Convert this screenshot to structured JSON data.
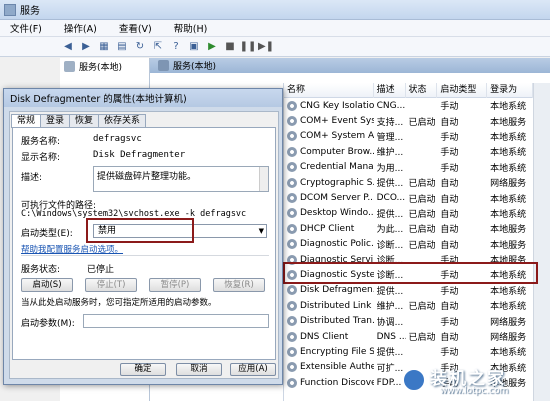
{
  "window": {
    "title": "服务"
  },
  "menu": [
    "文件(F)",
    "操作(A)",
    "查看(V)",
    "帮助(H)"
  ],
  "tree": {
    "item": "服务(本地)"
  },
  "panel_header": "服务(本地)",
  "table": {
    "columns": [
      "名称",
      "描述",
      "状态",
      "启动类型",
      "登录为"
    ],
    "rows": [
      [
        "CNG Key Isolation",
        "CNG...",
        "",
        "手动",
        "本地系统"
      ],
      [
        "COM+ Event Sys...",
        "支持...",
        "已启动",
        "自动",
        "本地服务"
      ],
      [
        "COM+ System A...",
        "管理...",
        "",
        "手动",
        "本地系统"
      ],
      [
        "Computer Brow...",
        "维护...",
        "",
        "手动",
        "本地系统"
      ],
      [
        "Credential Mana...",
        "为用...",
        "",
        "手动",
        "本地系统"
      ],
      [
        "Cryptographic S...",
        "提供...",
        "已启动",
        "自动",
        "网络服务"
      ],
      [
        "DCOM Server P...",
        "DCO...",
        "已启动",
        "自动",
        "本地系统"
      ],
      [
        "Desktop Windo...",
        "提供...",
        "已启动",
        "自动",
        "本地系统"
      ],
      [
        "DHCP Client",
        "为此...",
        "已启动",
        "自动",
        "本地服务"
      ],
      [
        "Diagnostic Polic...",
        "诊断...",
        "已启动",
        "自动",
        "本地服务"
      ],
      [
        "Diagnostic Servi...",
        "诊断...",
        "",
        "手动",
        "本地服务"
      ],
      [
        "Diagnostic Syste...",
        "诊断...",
        "",
        "手动",
        "本地系统"
      ],
      [
        "Disk Defragmen...",
        "提供...",
        "",
        "手动",
        "本地系统"
      ],
      [
        "Distributed Link ...",
        "维护...",
        "已启动",
        "自动",
        "本地系统"
      ],
      [
        "Distributed Tran...",
        "协调...",
        "",
        "手动",
        "网络服务"
      ],
      [
        "DNS Client",
        "DNS ...",
        "已启动",
        "自动",
        "网络服务"
      ],
      [
        "Encrypting File S...",
        "提供...",
        "",
        "手动",
        "本地系统"
      ],
      [
        "Extensible Authe...",
        "可扩...",
        "",
        "手动",
        "本地系统"
      ],
      [
        "Function Discove...",
        "FDP...",
        "",
        "手动",
        "本地服务"
      ]
    ]
  },
  "dialog": {
    "title": "Disk Defragmenter 的属性(本地计算机)",
    "tabs": [
      "常规",
      "登录",
      "恢复",
      "依存关系"
    ],
    "service_name_label": "服务名称:",
    "service_name": "defragsvc",
    "display_name_label": "显示名称:",
    "display_name": "Disk Defragmenter",
    "description_label": "描述:",
    "description": "提供磁盘碎片整理功能。",
    "path_label": "可执行文件的路径:",
    "path": "C:\\Windows\\system32\\svchost.exe -k defragsvc",
    "startup_label": "启动类型(E):",
    "startup_value": "禁用",
    "help_link": "帮助我配置服务启动选项。",
    "status_label": "服务状态:",
    "status_value": "已停止",
    "buttons": {
      "start": "启动(S)",
      "stop": "停止(T)",
      "pause": "暂停(P)",
      "resume": "恢复(R)"
    },
    "hint": "当从此处启动服务时，您可指定所适用的启动参数。",
    "param_label": "启动参数(M):",
    "ok": "确定",
    "cancel": "取消",
    "apply": "应用(A)"
  },
  "watermark": {
    "title": "装机之家",
    "url": "www.lotpc.com"
  }
}
